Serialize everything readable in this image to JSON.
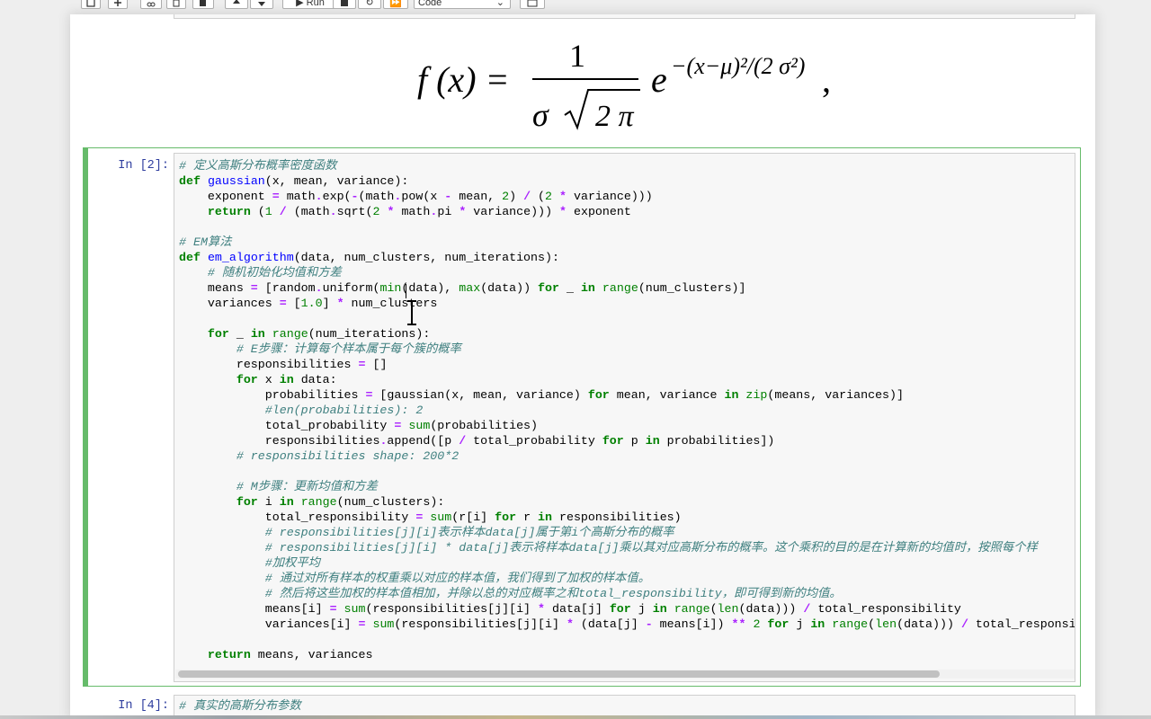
{
  "toolbar": {
    "run_label": "Run",
    "cell_type": "Code",
    "buttons": [
      "save-icon",
      "add-cell-icon",
      "cut-icon",
      "copy-icon",
      "paste-icon",
      "move-up-icon",
      "move-down-icon",
      "run-icon",
      "stop-icon",
      "restart-icon",
      "fast-forward-icon",
      "keyboard-icon"
    ]
  },
  "formula": {
    "lhs": "f (x) =",
    "numerator": "1",
    "denominator_sigma": "σ",
    "sqrt_content": "2 π",
    "exp_base": "e",
    "exponent": "−(x−μ)²/(2 σ²)",
    "trailing": ","
  },
  "cell2": {
    "prompt": "In [2]:",
    "lines": [
      [
        [
          "c",
          "# 定义高斯分布概率密度函数"
        ]
      ],
      [
        [
          "k",
          "def"
        ],
        [
          "t",
          " "
        ],
        [
          "f",
          "gaussian"
        ],
        [
          "t",
          "(x, mean, variance):"
        ]
      ],
      [
        [
          "t",
          "    exponent "
        ],
        [
          "o",
          "="
        ],
        [
          "t",
          " math"
        ],
        [
          "o",
          "."
        ],
        [
          "t",
          "exp("
        ],
        [
          "o",
          "-"
        ],
        [
          "t",
          "(math"
        ],
        [
          "o",
          "."
        ],
        [
          "t",
          "pow(x "
        ],
        [
          "o",
          "-"
        ],
        [
          "t",
          " mean, "
        ],
        [
          "n",
          "2"
        ],
        [
          "t",
          ") "
        ],
        [
          "o",
          "/"
        ],
        [
          "t",
          " ("
        ],
        [
          "n",
          "2"
        ],
        [
          "t",
          " "
        ],
        [
          "o",
          "*"
        ],
        [
          "t",
          " variance)))"
        ]
      ],
      [
        [
          "t",
          "    "
        ],
        [
          "k",
          "return"
        ],
        [
          "t",
          " ("
        ],
        [
          "n",
          "1"
        ],
        [
          "t",
          " "
        ],
        [
          "o",
          "/"
        ],
        [
          "t",
          " (math"
        ],
        [
          "o",
          "."
        ],
        [
          "t",
          "sqrt("
        ],
        [
          "n",
          "2"
        ],
        [
          "t",
          " "
        ],
        [
          "o",
          "*"
        ],
        [
          "t",
          " math"
        ],
        [
          "o",
          "."
        ],
        [
          "t",
          "pi "
        ],
        [
          "o",
          "*"
        ],
        [
          "t",
          " variance))) "
        ],
        [
          "o",
          "*"
        ],
        [
          "t",
          " exponent"
        ]
      ],
      [
        [
          "t",
          ""
        ]
      ],
      [
        [
          "c",
          "# EM算法"
        ]
      ],
      [
        [
          "k",
          "def"
        ],
        [
          "t",
          " "
        ],
        [
          "f",
          "em_algorithm"
        ],
        [
          "t",
          "(data, num_clusters, num_iterations):"
        ]
      ],
      [
        [
          "t",
          "    "
        ],
        [
          "c",
          "# 随机初始化均值和方差"
        ]
      ],
      [
        [
          "t",
          "    means "
        ],
        [
          "o",
          "="
        ],
        [
          "t",
          " [random"
        ],
        [
          "o",
          "."
        ],
        [
          "t",
          "uniform("
        ],
        [
          "b",
          "min"
        ],
        [
          "t",
          "(data), "
        ],
        [
          "b",
          "max"
        ],
        [
          "t",
          "(data)) "
        ],
        [
          "k",
          "for"
        ],
        [
          "t",
          " _ "
        ],
        [
          "k",
          "in"
        ],
        [
          "t",
          " "
        ],
        [
          "b",
          "range"
        ],
        [
          "t",
          "(num_clusters)]"
        ]
      ],
      [
        [
          "t",
          "    variances "
        ],
        [
          "o",
          "="
        ],
        [
          "t",
          " ["
        ],
        [
          "n",
          "1.0"
        ],
        [
          "t",
          "] "
        ],
        [
          "o",
          "*"
        ],
        [
          "t",
          " num_clusters"
        ]
      ],
      [
        [
          "t",
          ""
        ]
      ],
      [
        [
          "t",
          "    "
        ],
        [
          "k",
          "for"
        ],
        [
          "t",
          " _ "
        ],
        [
          "k",
          "in"
        ],
        [
          "t",
          " "
        ],
        [
          "b",
          "range"
        ],
        [
          "t",
          "(num_iterations):"
        ]
      ],
      [
        [
          "t",
          "        "
        ],
        [
          "c",
          "# E步骤：计算每个样本属于每个簇的概率"
        ]
      ],
      [
        [
          "t",
          "        responsibilities "
        ],
        [
          "o",
          "="
        ],
        [
          "t",
          " []"
        ]
      ],
      [
        [
          "t",
          "        "
        ],
        [
          "k",
          "for"
        ],
        [
          "t",
          " x "
        ],
        [
          "k",
          "in"
        ],
        [
          "t",
          " data:"
        ]
      ],
      [
        [
          "t",
          "            probabilities "
        ],
        [
          "o",
          "="
        ],
        [
          "t",
          " [gaussian(x, mean, variance) "
        ],
        [
          "k",
          "for"
        ],
        [
          "t",
          " mean, variance "
        ],
        [
          "k",
          "in"
        ],
        [
          "t",
          " "
        ],
        [
          "b",
          "zip"
        ],
        [
          "t",
          "(means, variances)]"
        ]
      ],
      [
        [
          "t",
          "            "
        ],
        [
          "c",
          "#len(probabilities): 2"
        ]
      ],
      [
        [
          "t",
          "            total_probability "
        ],
        [
          "o",
          "="
        ],
        [
          "t",
          " "
        ],
        [
          "b",
          "sum"
        ],
        [
          "t",
          "(probabilities)"
        ]
      ],
      [
        [
          "t",
          "            responsibilities"
        ],
        [
          "o",
          "."
        ],
        [
          "t",
          "append([p "
        ],
        [
          "o",
          "/"
        ],
        [
          "t",
          " total_probability "
        ],
        [
          "k",
          "for"
        ],
        [
          "t",
          " p "
        ],
        [
          "k",
          "in"
        ],
        [
          "t",
          " probabilities])"
        ]
      ],
      [
        [
          "t",
          "        "
        ],
        [
          "c",
          "# responsibilities shape: 200*2"
        ]
      ],
      [
        [
          "t",
          ""
        ]
      ],
      [
        [
          "t",
          "        "
        ],
        [
          "c",
          "# M步骤：更新均值和方差"
        ]
      ],
      [
        [
          "t",
          "        "
        ],
        [
          "k",
          "for"
        ],
        [
          "t",
          " i "
        ],
        [
          "k",
          "in"
        ],
        [
          "t",
          " "
        ],
        [
          "b",
          "range"
        ],
        [
          "t",
          "(num_clusters):"
        ]
      ],
      [
        [
          "t",
          "            total_responsibility "
        ],
        [
          "o",
          "="
        ],
        [
          "t",
          " "
        ],
        [
          "b",
          "sum"
        ],
        [
          "t",
          "(r[i] "
        ],
        [
          "k",
          "for"
        ],
        [
          "t",
          " r "
        ],
        [
          "k",
          "in"
        ],
        [
          "t",
          " responsibilities)"
        ]
      ],
      [
        [
          "t",
          "            "
        ],
        [
          "c",
          "# responsibilities[j][i]表示样本data[j]属于第i个高斯分布的概率"
        ]
      ],
      [
        [
          "t",
          "            "
        ],
        [
          "c",
          "# responsibilities[j][i] * data[j]表示将样本data[j]乘以其对应高斯分布的概率。这个乘积的目的是在计算新的均值时，按照每个样"
        ]
      ],
      [
        [
          "t",
          "            "
        ],
        [
          "c",
          "#加权平均"
        ]
      ],
      [
        [
          "t",
          "            "
        ],
        [
          "c",
          "# 通过对所有样本的权重乘以对应的样本值，我们得到了加权的样本值。"
        ]
      ],
      [
        [
          "t",
          "            "
        ],
        [
          "c",
          "# 然后将这些加权的样本值相加，并除以总的对应概率之和total_responsibility，即可得到新的均值。"
        ]
      ],
      [
        [
          "t",
          "            means[i] "
        ],
        [
          "o",
          "="
        ],
        [
          "t",
          " "
        ],
        [
          "b",
          "sum"
        ],
        [
          "t",
          "(responsibilities[j][i] "
        ],
        [
          "o",
          "*"
        ],
        [
          "t",
          " data[j] "
        ],
        [
          "k",
          "for"
        ],
        [
          "t",
          " j "
        ],
        [
          "k",
          "in"
        ],
        [
          "t",
          " "
        ],
        [
          "b",
          "range"
        ],
        [
          "t",
          "("
        ],
        [
          "b",
          "len"
        ],
        [
          "t",
          "(data))) "
        ],
        [
          "o",
          "/"
        ],
        [
          "t",
          " total_responsibility"
        ]
      ],
      [
        [
          "t",
          "            variances[i] "
        ],
        [
          "o",
          "="
        ],
        [
          "t",
          " "
        ],
        [
          "b",
          "sum"
        ],
        [
          "t",
          "(responsibilities[j][i] "
        ],
        [
          "o",
          "*"
        ],
        [
          "t",
          " (data[j] "
        ],
        [
          "o",
          "-"
        ],
        [
          "t",
          " means[i]) "
        ],
        [
          "o",
          "**"
        ],
        [
          "t",
          " "
        ],
        [
          "n",
          "2"
        ],
        [
          "t",
          " "
        ],
        [
          "k",
          "for"
        ],
        [
          "t",
          " j "
        ],
        [
          "k",
          "in"
        ],
        [
          "t",
          " "
        ],
        [
          "b",
          "range"
        ],
        [
          "t",
          "("
        ],
        [
          "b",
          "len"
        ],
        [
          "t",
          "(data))) "
        ],
        [
          "o",
          "/"
        ],
        [
          "t",
          " total_responsibility"
        ]
      ],
      [
        [
          "t",
          ""
        ]
      ],
      [
        [
          "t",
          "    "
        ],
        [
          "k",
          "return"
        ],
        [
          "t",
          " means, variances"
        ]
      ]
    ],
    "hscroll_fraction": 0.85
  },
  "cell4": {
    "prompt": "In [4]:",
    "first_line": "# 真实的高斯分布参数"
  }
}
